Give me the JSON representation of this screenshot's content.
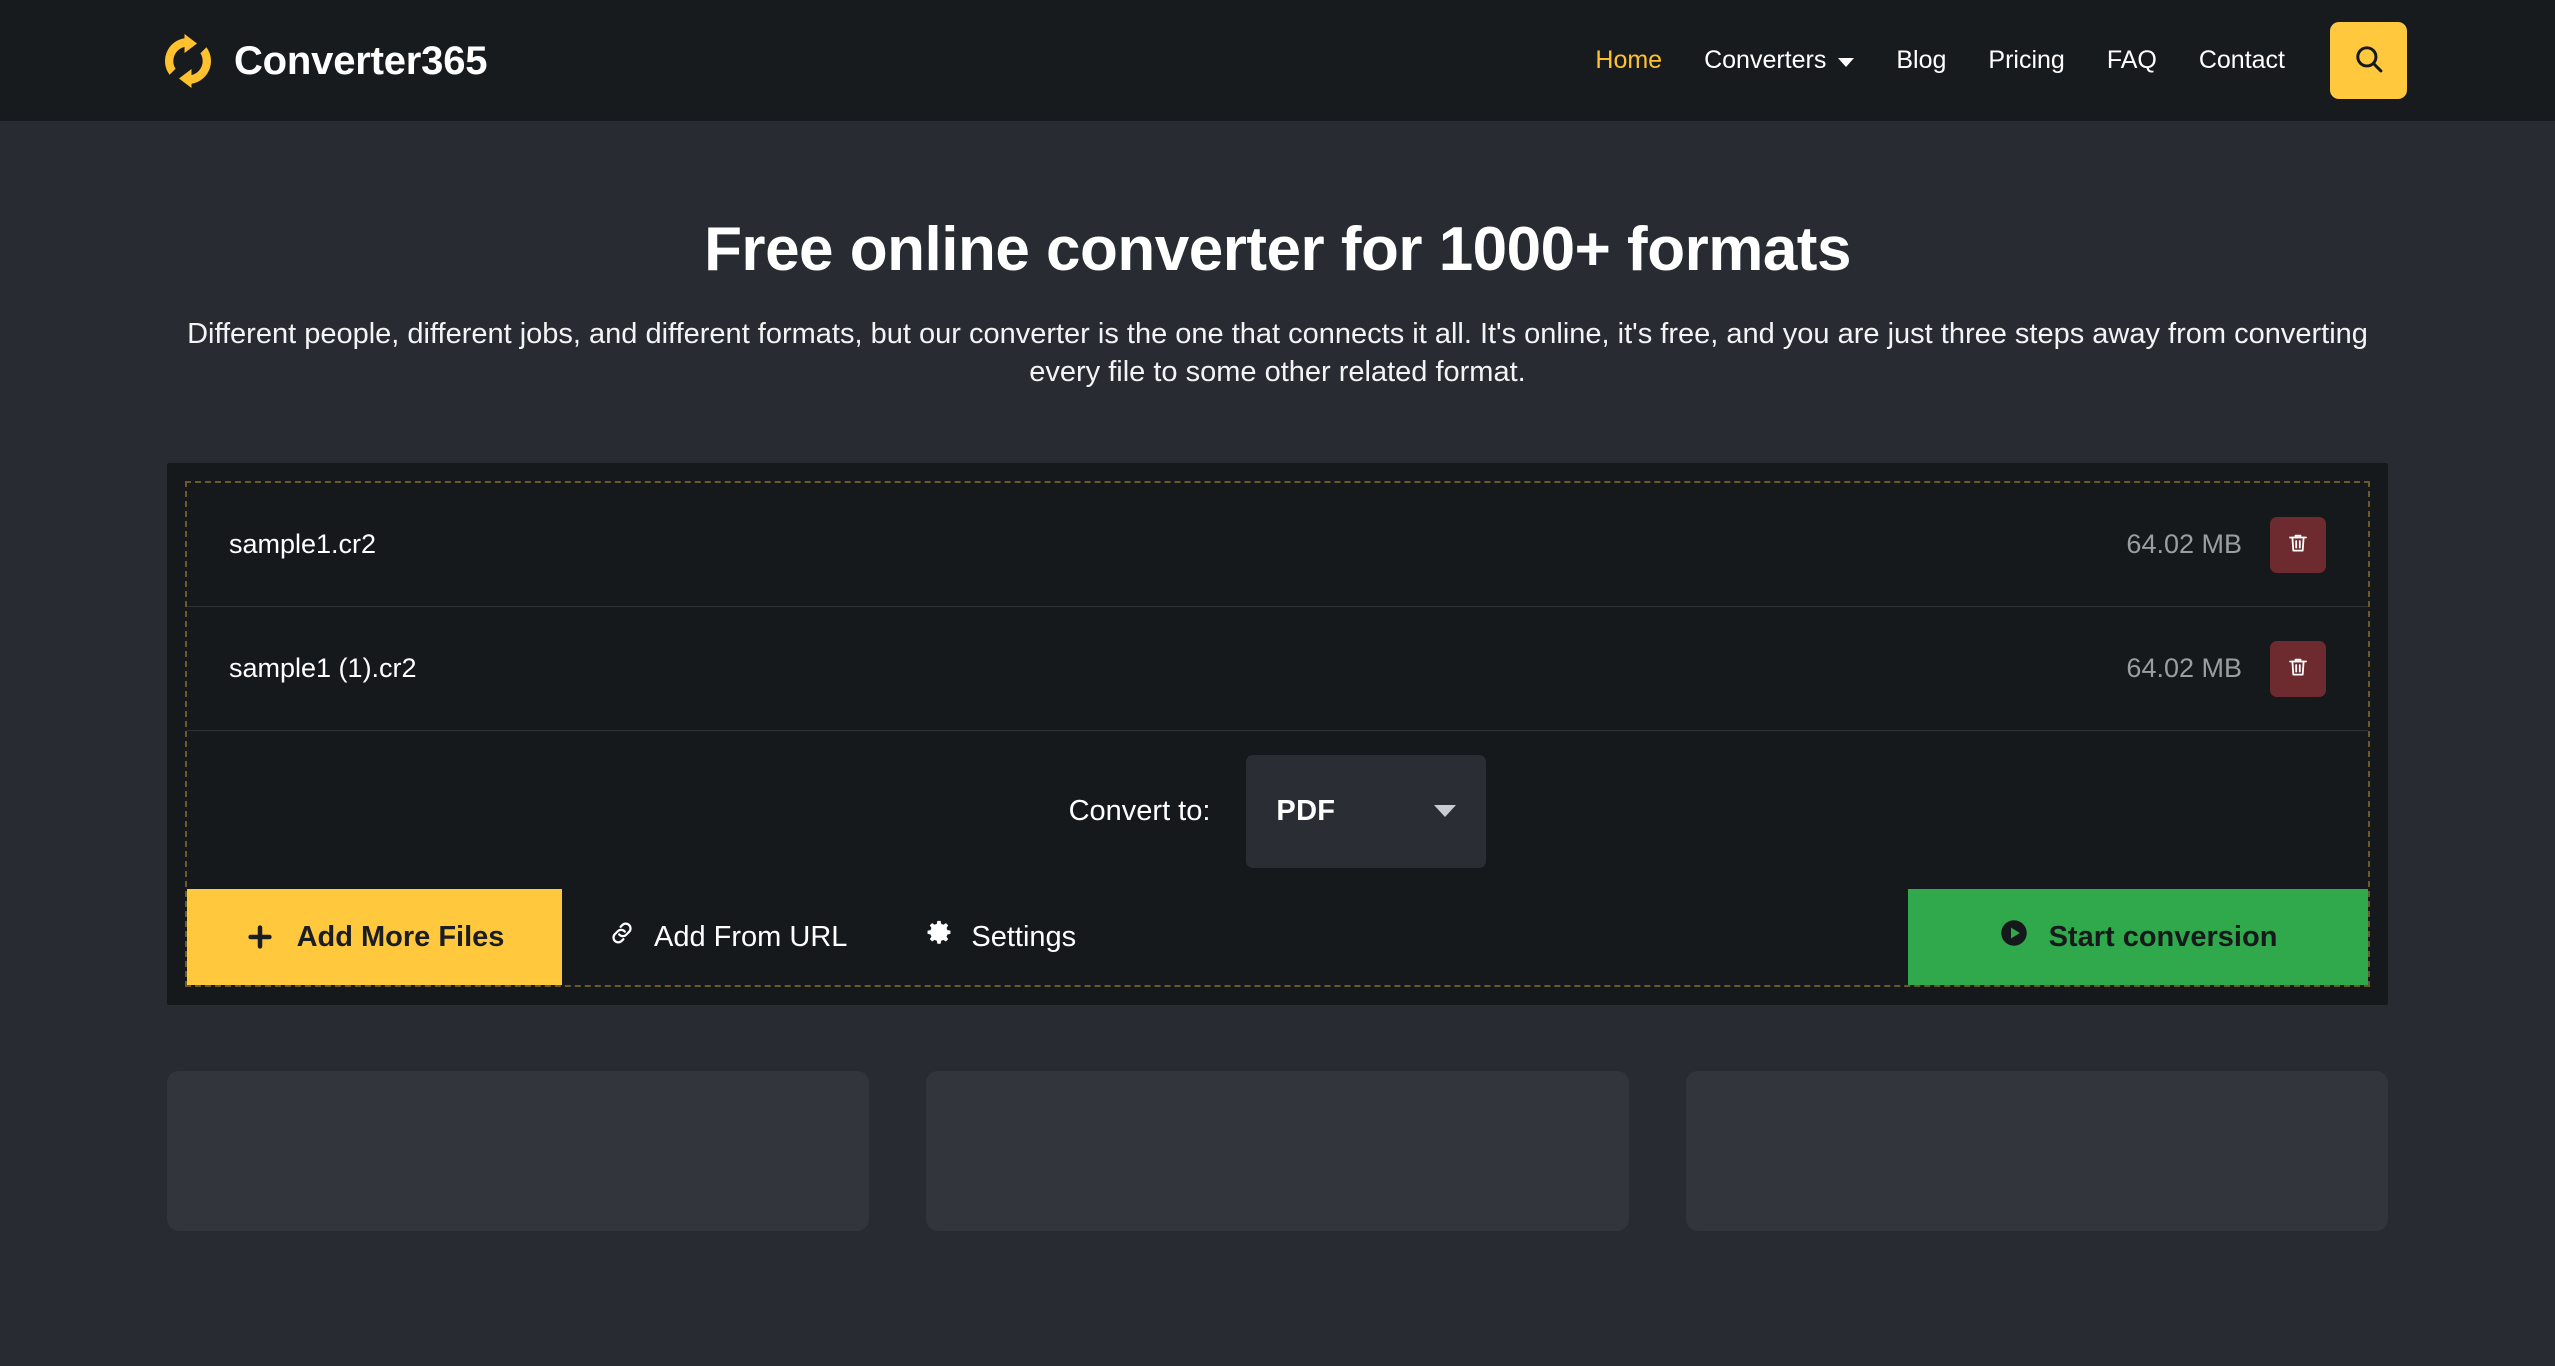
{
  "header": {
    "brand": {
      "name": "Converter365",
      "logo_icon": "sync-arrows-icon",
      "logo_color": "#ffc12e"
    },
    "nav": [
      {
        "label": "Home",
        "active": true,
        "has_dropdown": false
      },
      {
        "label": "Converters",
        "active": false,
        "has_dropdown": true
      },
      {
        "label": "Blog",
        "active": false,
        "has_dropdown": false
      },
      {
        "label": "Pricing",
        "active": false,
        "has_dropdown": false
      },
      {
        "label": "FAQ",
        "active": false,
        "has_dropdown": false
      },
      {
        "label": "Contact",
        "active": false,
        "has_dropdown": false
      }
    ],
    "search": {
      "icon": "search-icon",
      "background": "#ffc83d"
    }
  },
  "hero": {
    "title": "Free online converter for 1000+ formats",
    "subtitle": "Different people, different jobs, and different formats, but our converter is the one that connects it all. It's online, it's free, and you are just three steps away from converting every file to some other related format."
  },
  "converter": {
    "files": [
      {
        "name": "sample1.cr2",
        "size": "64.02 MB",
        "delete_icon": "trash-icon"
      },
      {
        "name": "sample1 (1).cr2",
        "size": "64.02 MB",
        "delete_icon": "trash-icon"
      }
    ],
    "convert_to_label": "Convert to:",
    "selected_format": "PDF",
    "format_options": [
      "PDF"
    ],
    "actions": {
      "add_more_files": "Add More Files",
      "add_from_url": "Add From URL",
      "settings": "Settings",
      "start_conversion": "Start conversion"
    },
    "colors": {
      "accent": "#ffc83d",
      "success": "#2fa94c",
      "danger": "#6d2b2f",
      "dropzone_border": "#6b5a28"
    }
  },
  "cards": [
    {
      "id": "card-1"
    },
    {
      "id": "card-2"
    },
    {
      "id": "card-3"
    }
  ]
}
